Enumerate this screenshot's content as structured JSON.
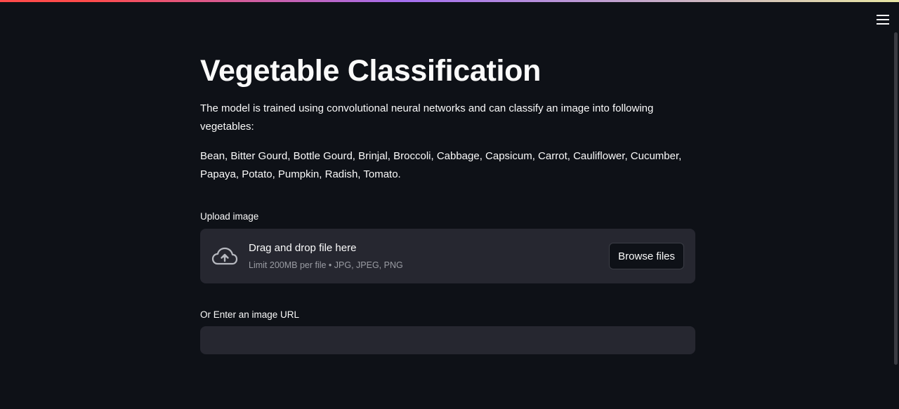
{
  "header": {
    "menu_icon": "hamburger-menu-icon"
  },
  "main": {
    "title": "Vegetable Classification",
    "description": "The model is trained using convolutional neural networks and can classify an image into following vegetables:",
    "vegetables": "Bean, Bitter Gourd, Bottle Gourd, Brinjal, Broccoli, Cabbage, Capsicum, Carrot, Cauliflower, Cucumber, Papaya, Potato, Pumpkin, Radish, Tomato."
  },
  "uploader": {
    "label": "Upload image",
    "drop_title": "Drag and drop file here",
    "drop_limit": "Limit 200MB per file • JPG, JPEG, PNG",
    "browse_label": "Browse files",
    "icon": "cloud-upload-icon"
  },
  "url_input": {
    "label": "Or Enter an image URL",
    "value": "",
    "placeholder": ""
  },
  "colors": {
    "background": "#0e1117",
    "widget": "#262730",
    "text": "#fafafa",
    "muted": "#9a9ca3"
  }
}
